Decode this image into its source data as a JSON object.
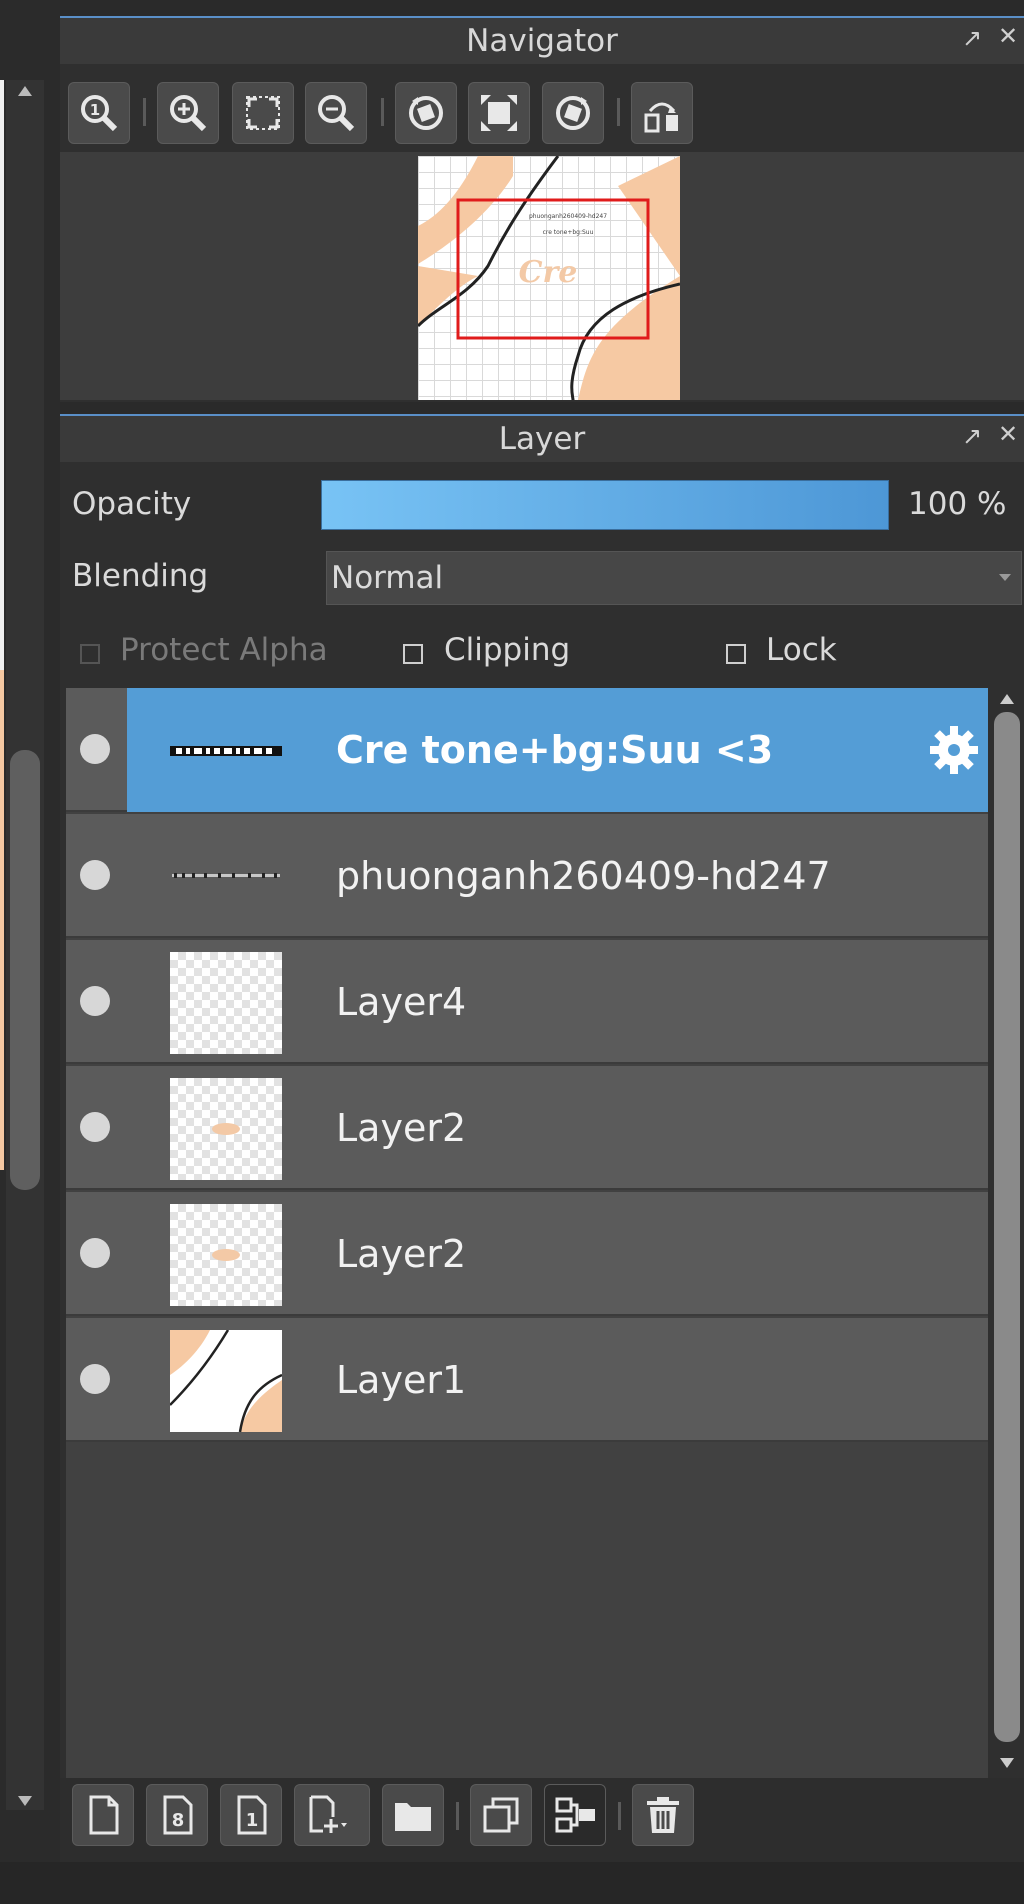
{
  "navigator": {
    "title": "Navigator",
    "tools": [
      {
        "name": "zoom-actual-icon"
      },
      {
        "name": "zoom-in-icon"
      },
      {
        "name": "fit-screen-icon"
      },
      {
        "name": "zoom-out-icon"
      },
      {
        "name": "rotate-left-icon"
      },
      {
        "name": "reset-view-icon"
      },
      {
        "name": "rotate-right-icon"
      },
      {
        "name": "flip-horizontal-icon"
      }
    ],
    "preview": {
      "line1": "phuonganh260409-hd247",
      "line2": "cre tone+bg:Suu",
      "art_text": "Cre"
    }
  },
  "layer_panel": {
    "title": "Layer",
    "opacity_label": "Opacity",
    "opacity_value": "100 %",
    "opacity": 1.0,
    "blending_label": "Blending",
    "blending_value": "Normal",
    "protect_alpha_label": "Protect Alpha",
    "clipping_label": "Clipping",
    "lock_label": "Lock",
    "layers": [
      {
        "name": "Cre tone+bg:Suu <3",
        "selected": true,
        "thumb": "text-strip"
      },
      {
        "name": "phuonganh260409-hd247",
        "selected": false,
        "thumb": "text-strip-thin"
      },
      {
        "name": "Layer4",
        "selected": false,
        "thumb": "transparent"
      },
      {
        "name": "Layer2",
        "selected": false,
        "thumb": "lettering"
      },
      {
        "name": "Layer2",
        "selected": false,
        "thumb": "lettering"
      },
      {
        "name": "Layer1",
        "selected": false,
        "thumb": "background"
      }
    ]
  },
  "bottom_toolbar": [
    {
      "name": "new-layer-icon"
    },
    {
      "name": "new-8bit-layer-icon"
    },
    {
      "name": "new-1bit-layer-icon"
    },
    {
      "name": "add-layer-menu-icon"
    },
    {
      "name": "new-folder-icon"
    },
    {
      "name": "duplicate-layer-icon"
    },
    {
      "name": "merge-down-icon"
    },
    {
      "name": "delete-layer-icon"
    }
  ],
  "colors": {
    "accent": "#549dd6",
    "panel": "#2f2f2f",
    "row": "#5b5b5b",
    "peach": "#f6c9a3",
    "frame_red": "#e01b1b"
  }
}
